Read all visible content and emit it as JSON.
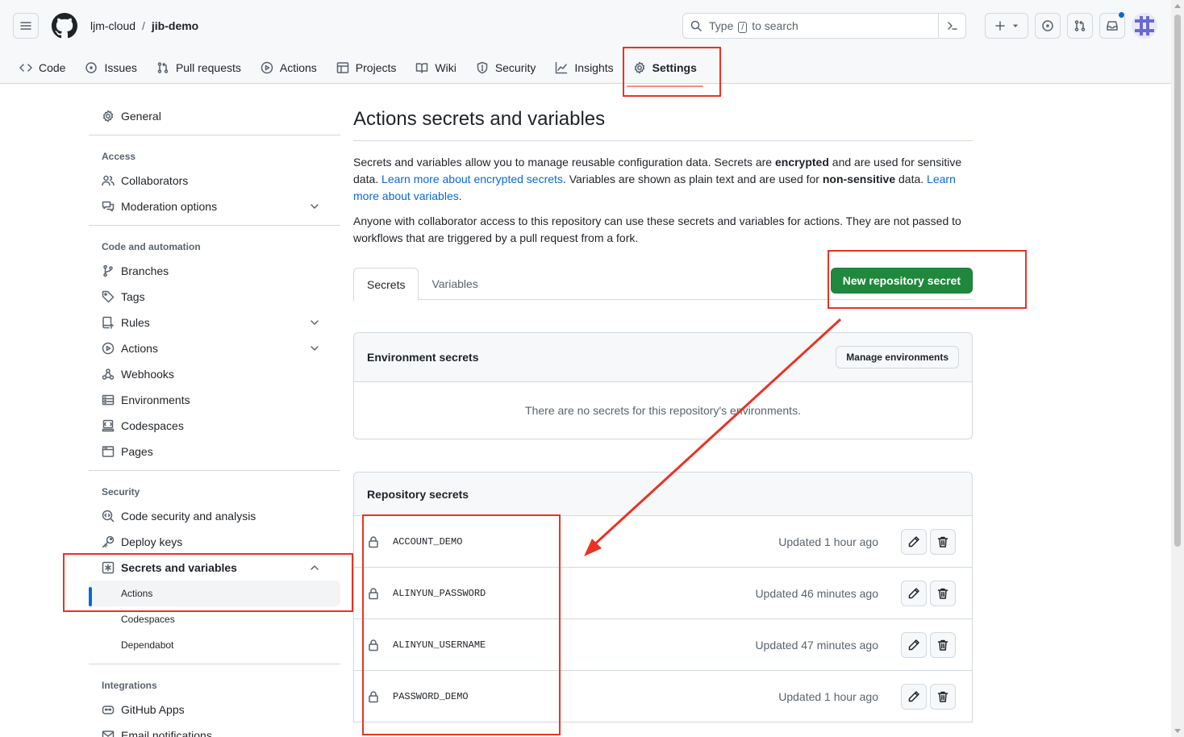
{
  "header": {
    "owner": "ljm-cloud",
    "separator": "/",
    "repo": "jib-demo",
    "search_placeholder_pre": "Type",
    "search_key": "/",
    "search_placeholder_post": "to search"
  },
  "repo_nav": [
    {
      "label": "Code",
      "icon": "code-icon"
    },
    {
      "label": "Issues",
      "icon": "issue-icon"
    },
    {
      "label": "Pull requests",
      "icon": "pull-request-icon"
    },
    {
      "label": "Actions",
      "icon": "play-icon"
    },
    {
      "label": "Projects",
      "icon": "table-icon"
    },
    {
      "label": "Wiki",
      "icon": "book-icon"
    },
    {
      "label": "Security",
      "icon": "shield-icon"
    },
    {
      "label": "Insights",
      "icon": "graph-icon"
    },
    {
      "label": "Settings",
      "icon": "gear-icon",
      "selected": true
    }
  ],
  "sidebar": {
    "general": "General",
    "access_heading": "Access",
    "collaborators": "Collaborators",
    "moderation": "Moderation options",
    "code_heading": "Code and automation",
    "branches": "Branches",
    "tags": "Tags",
    "rules": "Rules",
    "actions": "Actions",
    "webhooks": "Webhooks",
    "environments": "Environments",
    "codespaces": "Codespaces",
    "pages": "Pages",
    "security_heading": "Security",
    "code_security": "Code security and analysis",
    "deploy_keys": "Deploy keys",
    "secrets_vars": "Secrets and variables",
    "sub_actions": "Actions",
    "sub_codespaces": "Codespaces",
    "sub_dependabot": "Dependabot",
    "integrations_heading": "Integrations",
    "github_apps": "GitHub Apps",
    "email_notifications": "Email notifications"
  },
  "main": {
    "title": "Actions secrets and variables",
    "desc_1": "Secrets and variables allow you to manage reusable configuration data. Secrets are ",
    "desc_encrypted": "encrypted",
    "desc_2": " and are used for sensitive data. ",
    "desc_link1": "Learn more about encrypted secrets",
    "desc_3": ". Variables are shown as plain text and are used for ",
    "desc_nonsensitive": "non-sensitive",
    "desc_4": " data. ",
    "desc_link2": "Learn more about variables",
    "desc_5": ".",
    "desc_p2": "Anyone with collaborator access to this repository can use these secrets and variables for actions. They are not passed to workflows that are triggered by a pull request from a fork.",
    "tab_secrets": "Secrets",
    "tab_variables": "Variables",
    "new_secret_button": "New repository secret",
    "env_heading": "Environment secrets",
    "manage_env_button": "Manage environments",
    "env_empty": "There are no secrets for this repository's environments.",
    "repo_heading": "Repository secrets",
    "secrets": [
      {
        "name": "ACCOUNT_DEMO",
        "updated": "Updated 1 hour ago"
      },
      {
        "name": "ALINYUN_PASSWORD",
        "updated": "Updated 46 minutes ago"
      },
      {
        "name": "ALINYUN_USERNAME",
        "updated": "Updated 47 minutes ago"
      },
      {
        "name": "PASSWORD_DEMO",
        "updated": "Updated 1 hour ago"
      }
    ]
  },
  "colors": {
    "primary_green": "#1f883d",
    "link_blue": "#0969da",
    "annotation_red": "#ea3323",
    "nav_underline": "#fd8c73"
  }
}
